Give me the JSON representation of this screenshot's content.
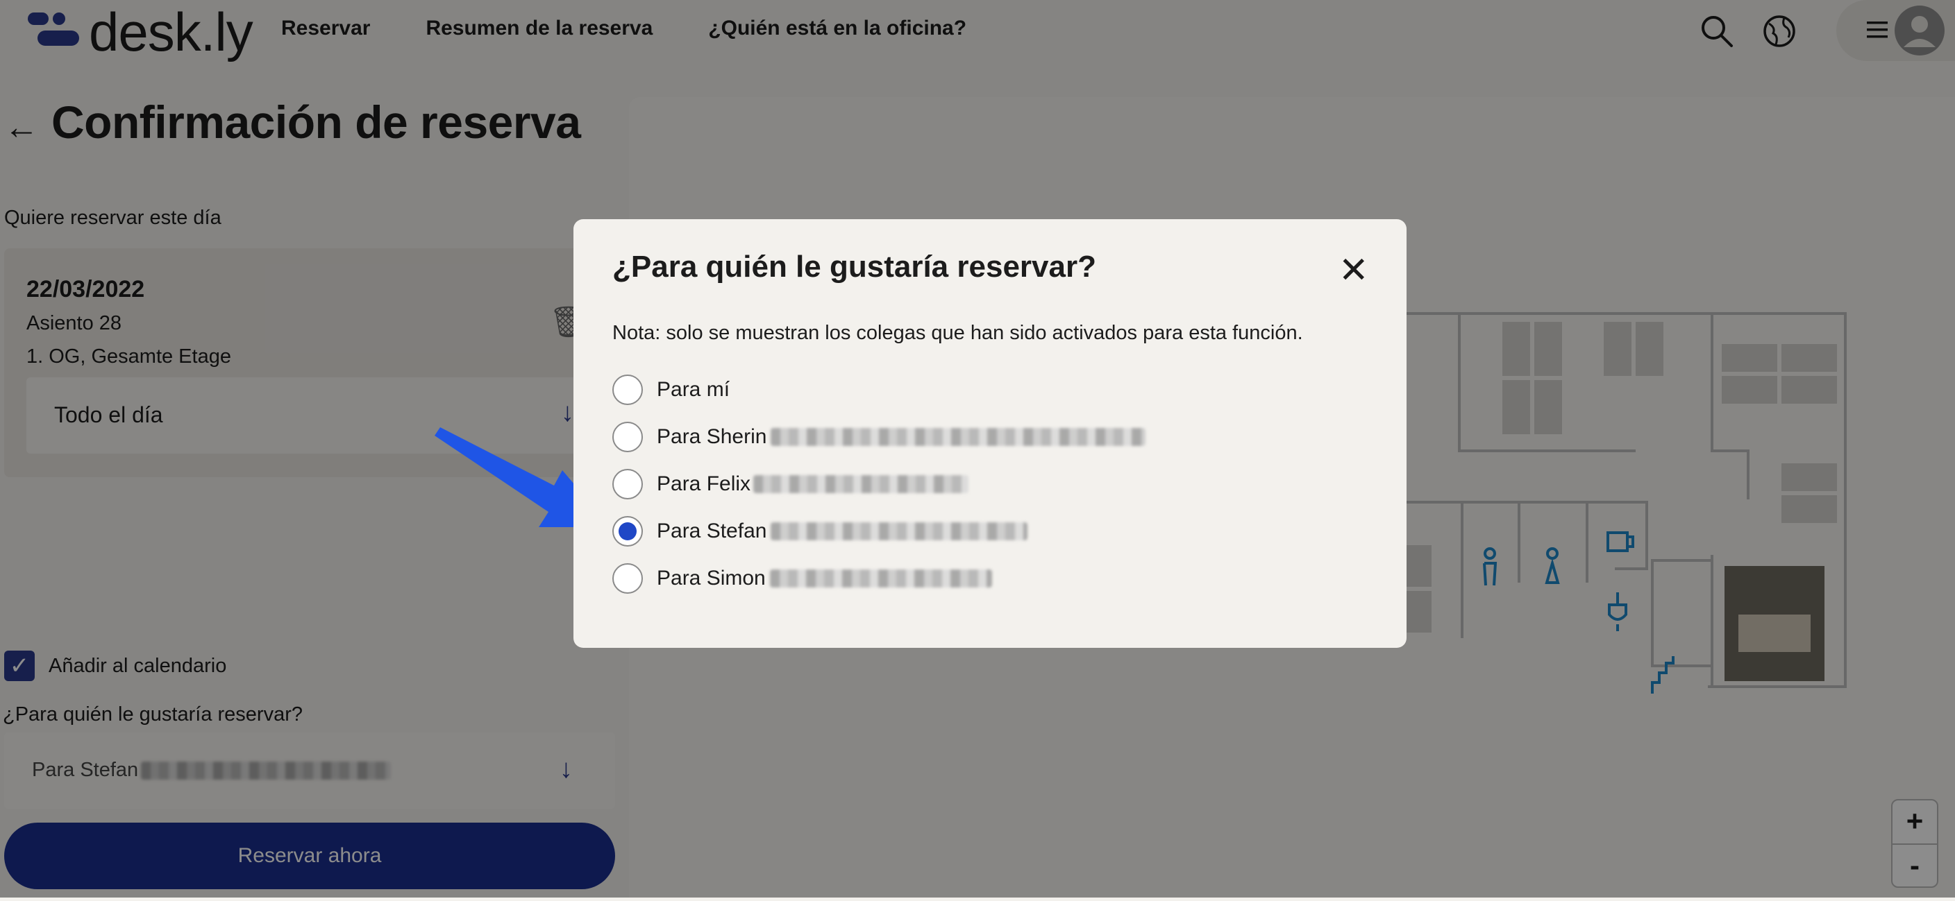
{
  "header": {
    "brand": "desk.ly",
    "nav": [
      "Reservar",
      "Resumen de la reserva",
      "¿Quién está en la oficina?"
    ]
  },
  "page": {
    "title": "Confirmación de reserva",
    "day_label": "Quiere reservar este día"
  },
  "booking": {
    "date": "22/03/2022",
    "seat": "Asiento 28",
    "floor": "1. OG, Gesamte Etage",
    "time": "Todo el día"
  },
  "form": {
    "add_calendar": "Añadir al calendario",
    "who_question": "¿Para quién le gustaría reservar?",
    "selected_person": "Para Stefan",
    "book_button": "Reservar ahora"
  },
  "modal": {
    "title": "¿Para quién le gustaría reservar?",
    "note": "Nota: solo se muestran los colegas que han sido activados para esta función.",
    "options": [
      {
        "label": "Para mí",
        "selected": false
      },
      {
        "label": "Para Sherin",
        "selected": false
      },
      {
        "label": "Para Felix",
        "selected": false
      },
      {
        "label": "Para Stefan",
        "selected": true
      },
      {
        "label": "Para Simon",
        "selected": false
      }
    ]
  },
  "zoom": {
    "in": "+",
    "out": "-"
  },
  "colors": {
    "brand": "#1a2f8e",
    "radio_selected": "#1f47c6",
    "annotation_arrow": "#1f55e6",
    "map_lines": "#bdbdbd",
    "map_icons": "#1e88c8"
  },
  "icons": [
    "search-icon",
    "globe-icon",
    "menu-icon",
    "user-avatar-icon",
    "back-arrow-icon",
    "trash-icon",
    "arrow-down-icon",
    "check-icon",
    "close-icon"
  ]
}
